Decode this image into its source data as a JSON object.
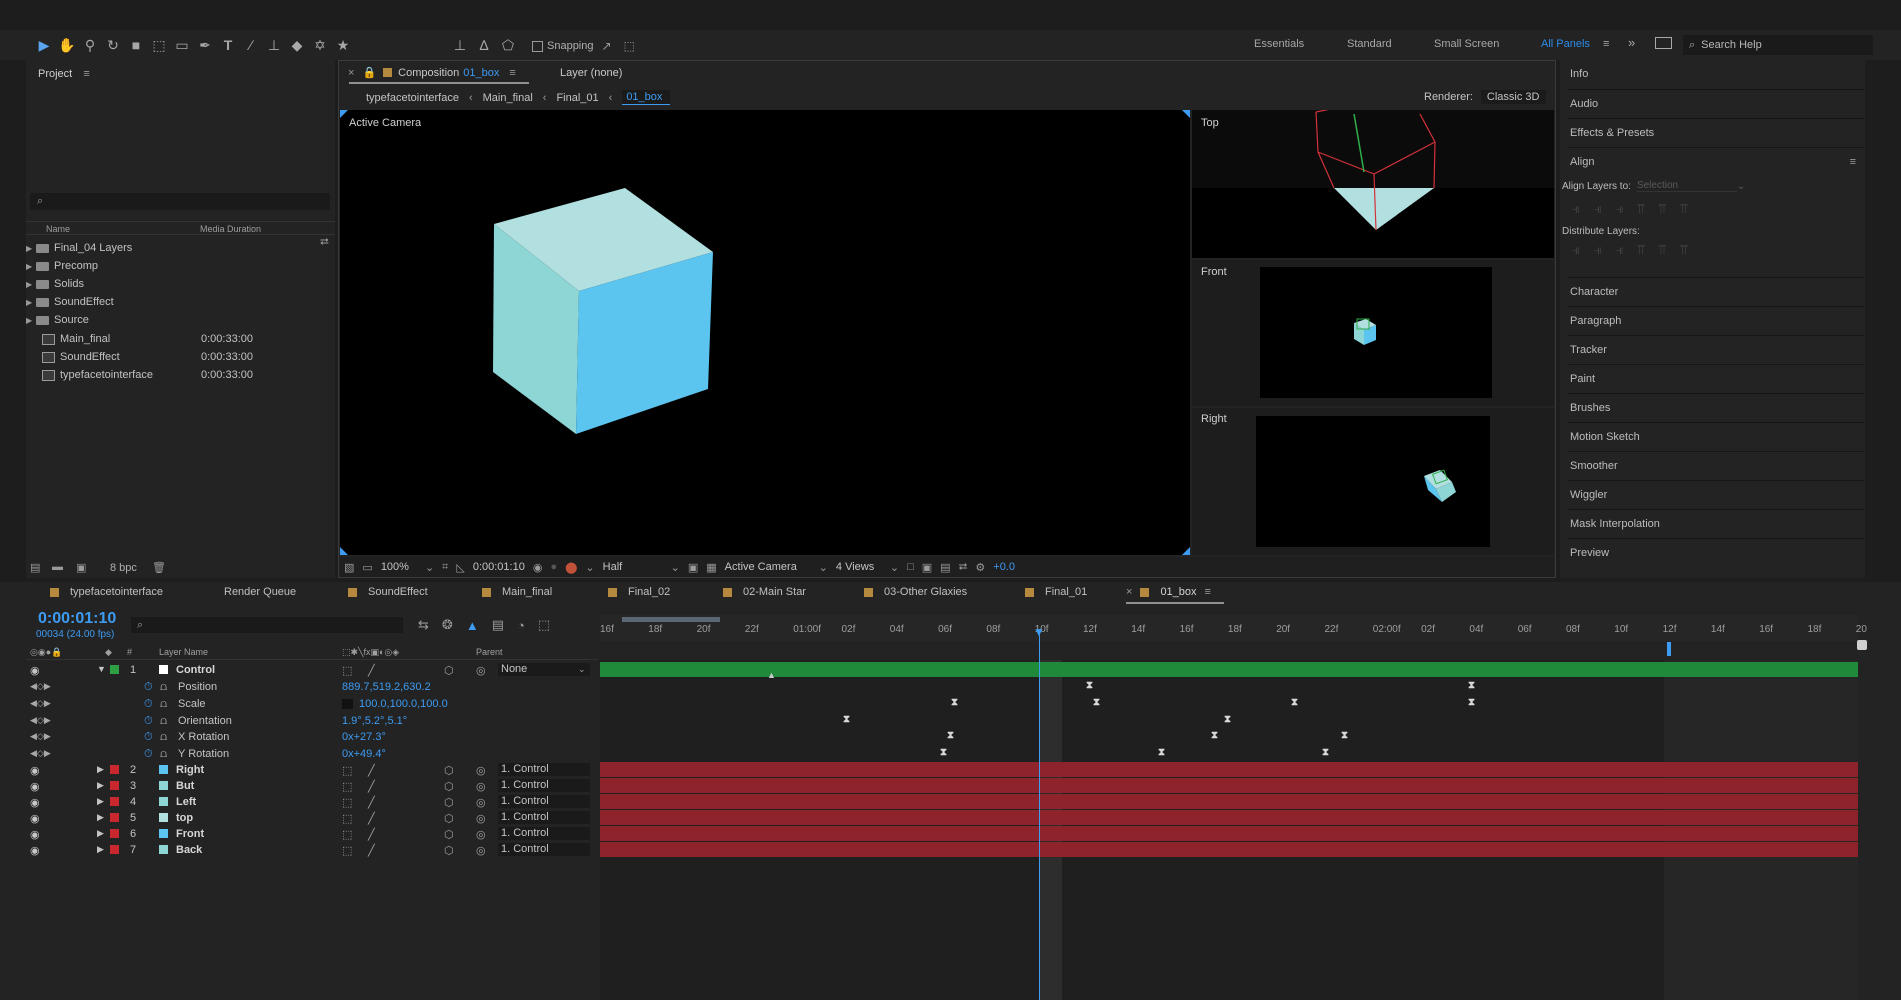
{
  "toolbar": {
    "snapping_label": "Snapping",
    "workspaces": [
      "Essentials",
      "Standard",
      "Small Screen",
      "All Panels"
    ],
    "active_workspace": "All Panels",
    "search_help": "Search Help"
  },
  "project": {
    "title": "Project",
    "col_name": "Name",
    "col_duration": "Media Duration",
    "items": [
      {
        "name": "Final_04 Layers",
        "type": "folder",
        "duration": ""
      },
      {
        "name": "Precomp",
        "type": "folder",
        "duration": ""
      },
      {
        "name": "Solids",
        "type": "folder",
        "duration": ""
      },
      {
        "name": "SoundEffect",
        "type": "folder",
        "duration": ""
      },
      {
        "name": "Source",
        "type": "folder",
        "duration": ""
      },
      {
        "name": "Main_final",
        "type": "comp",
        "duration": "0:00:33:00"
      },
      {
        "name": "SoundEffect",
        "type": "comp",
        "duration": "0:00:33:00"
      },
      {
        "name": "typefacetointerface",
        "type": "comp",
        "duration": "0:00:33:00"
      }
    ],
    "bpc": "8 bpc"
  },
  "composition": {
    "tab_label": "Composition",
    "tab_comp": "01_box",
    "layer_tab": "Layer (none)",
    "breadcrumbs": [
      "typefacetointerface",
      "Main_final",
      "Final_01",
      "01_box"
    ],
    "renderer_label": "Renderer:",
    "renderer_value": "Classic 3D",
    "main_view_label": "Active Camera",
    "views": [
      "Top",
      "Front",
      "Right"
    ],
    "bottom": {
      "zoom": "100%",
      "timecode": "0:00:01:10",
      "resolution": "Half",
      "camera": "Active Camera",
      "views": "4 Views",
      "exposure": "+0.0"
    }
  },
  "right_panel": {
    "items_top": [
      "Info",
      "Audio",
      "Effects & Presets"
    ],
    "align": {
      "title": "Align",
      "align_to_label": "Align Layers to:",
      "align_to_value": "Selection",
      "distribute_label": "Distribute Layers:"
    },
    "items_bottom": [
      "Character",
      "Paragraph",
      "Tracker",
      "Paint",
      "Brushes",
      "Motion Sketch",
      "Smoother",
      "Wiggler",
      "Mask Interpolation",
      "Preview"
    ]
  },
  "timeline": {
    "tabs": [
      {
        "label": "typefacetointerface",
        "color": "#b58a3f"
      },
      {
        "label": "Render Queue",
        "color": ""
      },
      {
        "label": "SoundEffect",
        "color": "#b58a3f"
      },
      {
        "label": "Main_final",
        "color": "#b58a3f"
      },
      {
        "label": "Final_02",
        "color": "#b58a3f"
      },
      {
        "label": "02-Main Star",
        "color": "#b58a3f"
      },
      {
        "label": "03-Other Glaxies",
        "color": "#b58a3f"
      },
      {
        "label": "Final_01",
        "color": "#b58a3f"
      },
      {
        "label": "01_box",
        "color": "#b58a3f"
      }
    ],
    "active_tab": "01_box",
    "timecode": "0:00:01:10",
    "frame_info": "00034 (24.00 fps)",
    "col_layer_name": "Layer Name",
    "col_parent": "Parent",
    "col_num": "#",
    "ruler": [
      "16f",
      "18f",
      "20f",
      "22f",
      "01:00f",
      "02f",
      "04f",
      "06f",
      "08f",
      "10f",
      "12f",
      "14f",
      "16f",
      "18f",
      "20f",
      "22f",
      "02:00f",
      "02f",
      "04f",
      "06f",
      "08f",
      "10f",
      "12f",
      "14f",
      "16f",
      "18f",
      "20"
    ],
    "control_layer": {
      "num": "1",
      "name": "Control",
      "parent": "None"
    },
    "properties": [
      {
        "name": "Position",
        "value": "889.7,519.2,630.2"
      },
      {
        "name": "Scale",
        "value": "100.0,100.0,100.0"
      },
      {
        "name": "Orientation",
        "value": "1.9°,5.2°,5.1°"
      },
      {
        "name": "X Rotation",
        "value": "0x+27.3°"
      },
      {
        "name": "Y Rotation",
        "value": "0x+49.4°"
      }
    ],
    "layers": [
      {
        "num": "2",
        "name": "Right",
        "parent": "1. Control"
      },
      {
        "num": "3",
        "name": "But",
        "parent": "1. Control"
      },
      {
        "num": "4",
        "name": "Left",
        "parent": "1. Control"
      },
      {
        "num": "5",
        "name": "top",
        "parent": "1. Control"
      },
      {
        "num": "6",
        "name": "Front",
        "parent": "1. Control"
      },
      {
        "num": "7",
        "name": "Back",
        "parent": "1. Control"
      }
    ],
    "colors": {
      "control_bar": "#1e8a3a",
      "layer_bar": "#8f232b",
      "label_green": "#2ea043",
      "label_red": "#c8282e",
      "current_time": "#3d9bf2"
    }
  }
}
